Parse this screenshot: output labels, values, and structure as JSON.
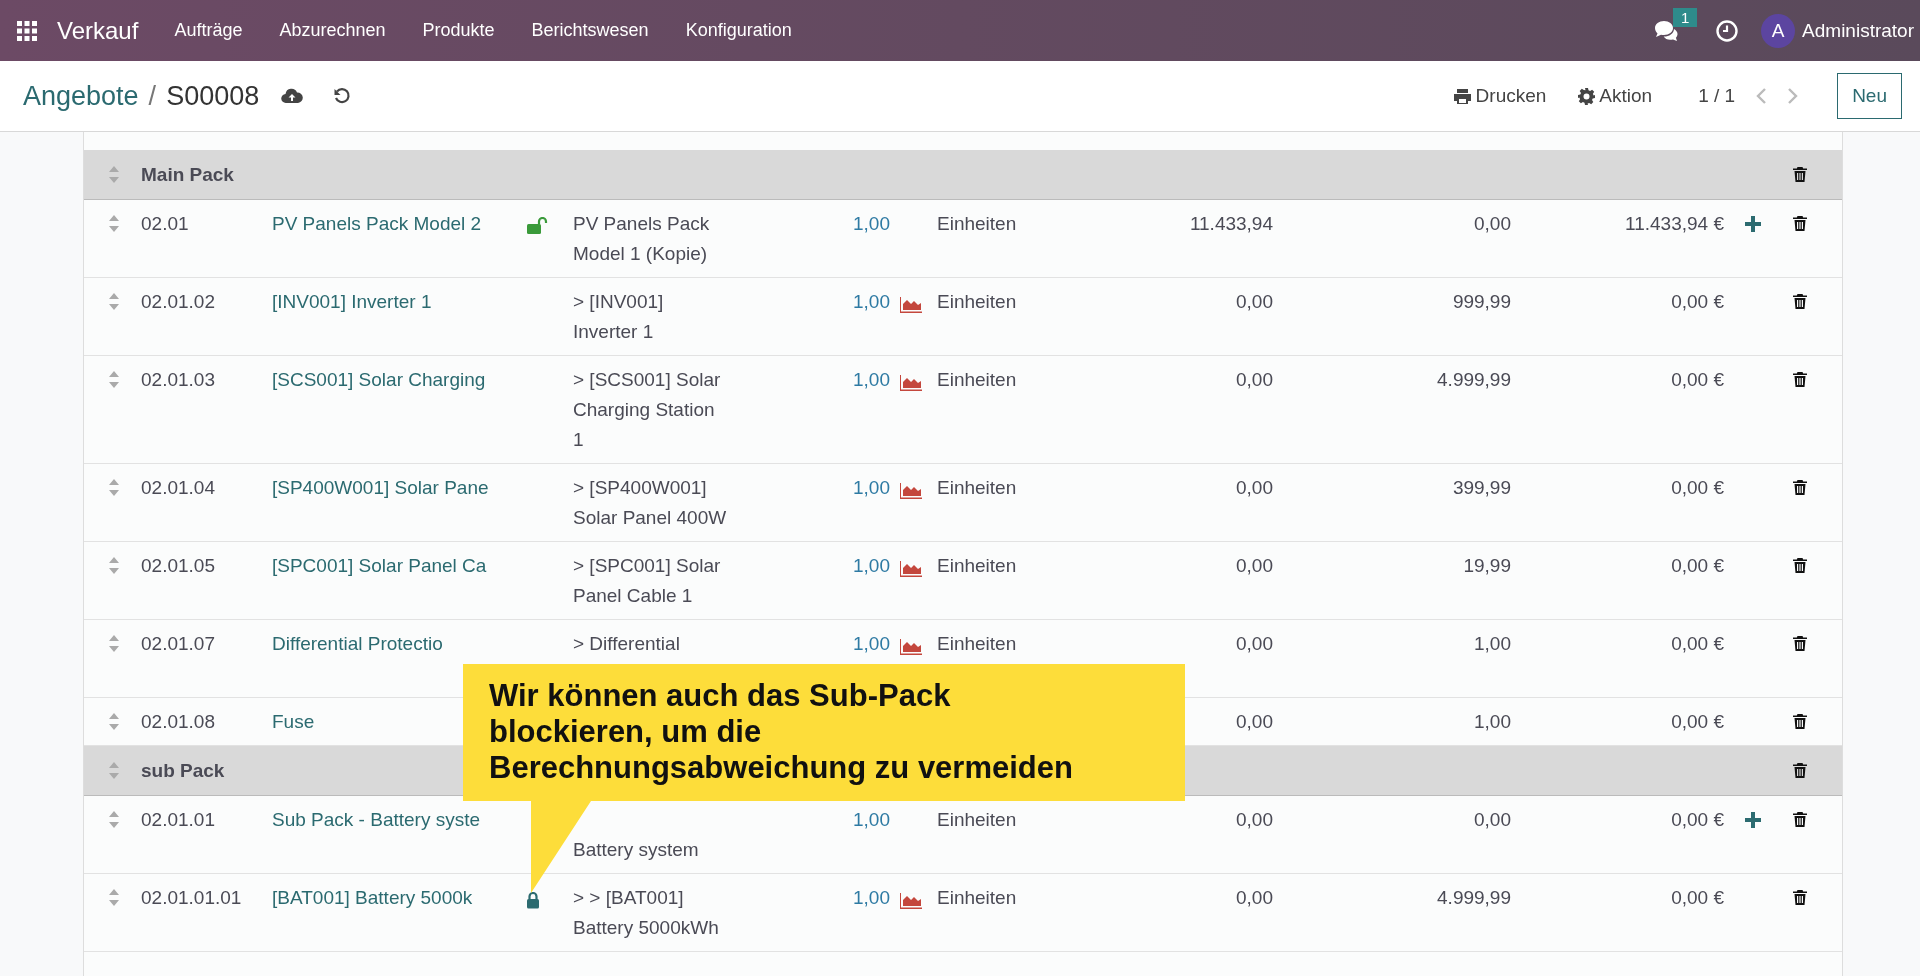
{
  "navbar": {
    "app_name": "Verkauf",
    "menu": [
      "Aufträge",
      "Abzurechnen",
      "Produkte",
      "Berichtswesen",
      "Konfiguration"
    ],
    "message_count": "1",
    "avatar_letter": "A",
    "user": "Administrator"
  },
  "control_panel": {
    "breadcrumb": [
      "Angebote",
      "S00008"
    ],
    "separator": "/",
    "print": "Drucken",
    "action": "Aktion",
    "pager": "1 / 1",
    "new_button": "Neu"
  },
  "lines": [
    {
      "kind": "section",
      "label": "Main Pack"
    },
    {
      "kind": "item",
      "seq": "02.01",
      "product": "PV Panels Pack Model 2",
      "locked": false,
      "desc": "PV Panels Pack\nModel 1 (Kopie)",
      "qty": "1,00",
      "forecast": false,
      "unit": "Einheiten",
      "number_1": "11.433,94",
      "number_2": "0,00",
      "total": "11.433,94 €",
      "add": true
    },
    {
      "kind": "item",
      "seq": "02.01.02",
      "product": "[INV001] Inverter 1",
      "desc": "> [INV001]\nInverter 1",
      "qty": "1,00",
      "forecast": true,
      "unit": "Einheiten",
      "number_1": "0,00",
      "number_2": "999,99",
      "total": "0,00 €",
      "add": false
    },
    {
      "kind": "item",
      "seq": "02.01.03",
      "product": "[SCS001] Solar Charging",
      "desc": "> [SCS001] Solar\nCharging Station\n1",
      "qty": "1,00",
      "forecast": true,
      "unit": "Einheiten",
      "number_1": "0,00",
      "number_2": "4.999,99",
      "total": "0,00 €",
      "add": false
    },
    {
      "kind": "item",
      "seq": "02.01.04",
      "product": "[SP400W001] Solar Pane",
      "desc": "> [SP400W001]\nSolar Panel 400W",
      "qty": "1,00",
      "forecast": true,
      "unit": "Einheiten",
      "number_1": "0,00",
      "number_2": "399,99",
      "total": "0,00 €",
      "add": false
    },
    {
      "kind": "item",
      "seq": "02.01.05",
      "product": "[SPC001] Solar Panel Ca",
      "desc": "> [SPC001] Solar\nPanel Cable 1",
      "qty": "1,00",
      "forecast": true,
      "unit": "Einheiten",
      "number_1": "0,00",
      "number_2": "19,99",
      "total": "0,00 €",
      "add": false
    },
    {
      "kind": "item",
      "seq": "02.01.07",
      "product": "Differential Protectio",
      "desc": "> Differential",
      "desc_continues": true,
      "qty": "1,00",
      "forecast": true,
      "unit": "Einheiten",
      "number_1": "0,00",
      "number_2": "1,00",
      "total": "0,00 €",
      "add": false
    },
    {
      "kind": "item",
      "seq": "02.01.08",
      "product": "Fuse",
      "number_1": "0,00",
      "number_2": "1,00",
      "total": "0,00 €",
      "add": false,
      "forecast": false
    },
    {
      "kind": "section",
      "label": "sub Pack"
    },
    {
      "kind": "item",
      "seq": "02.01.01",
      "product": "Sub Pack - Battery syste",
      "desc": "Battery system",
      "desc_first_line_hidden": true,
      "qty": "1,00",
      "forecast": false,
      "unit": "Einheiten",
      "number_1": "0,00",
      "number_2": "0,00",
      "total": "0,00 €",
      "add": true
    },
    {
      "kind": "item",
      "seq": "02.01.01.01",
      "product": "[BAT001] Battery 5000k",
      "locked": true,
      "desc": "> > [BAT001]\nBattery 5000kWh",
      "qty": "1,00",
      "forecast": true,
      "unit": "Einheiten",
      "number_1": "0,00",
      "number_2": "4.999,99",
      "total": "0,00 €",
      "add": false
    }
  ],
  "callout": {
    "text": "Wir können auch das Sub-Pack\nblockieren, um die\nBerechnungsabweichung zu vermeiden"
  }
}
